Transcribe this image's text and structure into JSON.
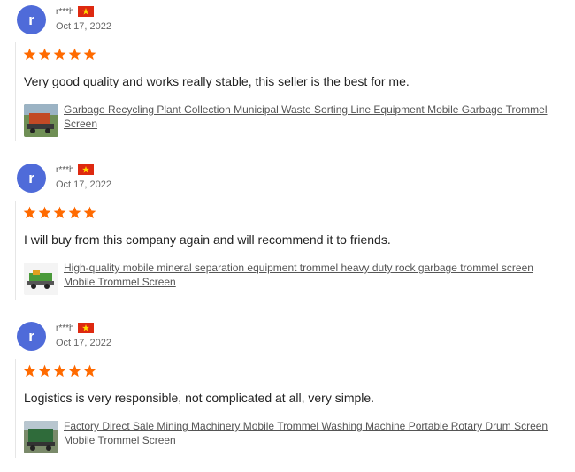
{
  "reviews": [
    {
      "avatar_letter": "r",
      "username": "r***h",
      "date": "Oct 17, 2022",
      "rating": 5,
      "text": "Very good quality and works really stable, this seller is the best for me.",
      "product_line1": "Garbage Recycling Plant Collection Municipal Waste Sorting Line Equipment Mobile Garbage Trommel",
      "product_line2": "Screen"
    },
    {
      "avatar_letter": "r",
      "username": "r***h",
      "date": "Oct 17, 2022",
      "rating": 5,
      "text": "I will buy from this company again and will recommend it to friends.",
      "product_line1": "High-quality mobile mineral separation equipment trommel heavy duty rock garbage trommel screen",
      "product_line2": "Mobile Trommel Screen"
    },
    {
      "avatar_letter": "r",
      "username": "r***h",
      "date": "Oct 17, 2022",
      "rating": 5,
      "text": "Logistics is very responsible, not complicated at all, very simple.",
      "product_line1": "Factory Direct Sale Mining Machinery Mobile Trommel Washing Machine Portable Rotary Drum Screen",
      "product_line2": "Mobile Trommel Screen"
    }
  ],
  "colors": {
    "avatar": "#4f6bd9",
    "star": "#ff6a00",
    "flag_red": "#de2910",
    "flag_star": "#ffde00"
  }
}
